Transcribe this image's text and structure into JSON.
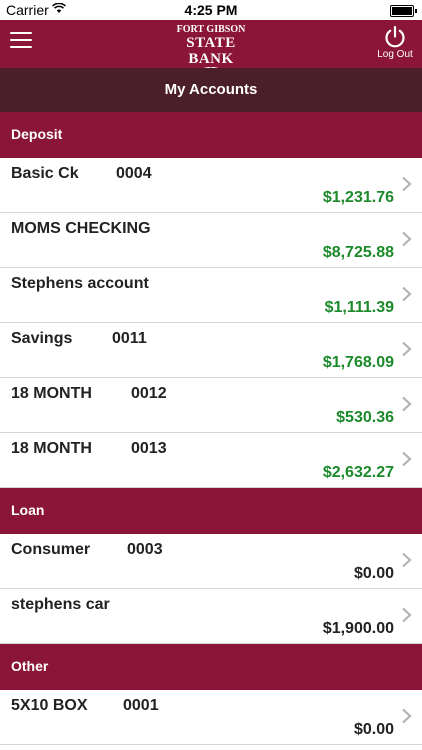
{
  "status_bar": {
    "carrier": "Carrier",
    "time": "4:25 PM"
  },
  "header": {
    "logo": {
      "line1": "FORT GIBSON",
      "line2": "STATE BANK"
    },
    "logout_label": "Log Out"
  },
  "title": "My Accounts",
  "sections": {
    "deposit": {
      "label": "Deposit",
      "accounts": [
        {
          "name": "Basic Ck",
          "number": "0004",
          "amount": "$1,231.76"
        },
        {
          "name": "MOMS CHECKING",
          "number": "",
          "amount": "$8,725.88"
        },
        {
          "name": "Stephens account",
          "number": "",
          "amount": "$1,111.39"
        },
        {
          "name": "Savings",
          "number": "0011",
          "amount": "$1,768.09"
        },
        {
          "name": "18 MONTH",
          "number": "0012",
          "amount": "$530.36"
        },
        {
          "name": "18 MONTH",
          "number": "0013",
          "amount": "$2,632.27"
        }
      ]
    },
    "loan": {
      "label": "Loan",
      "accounts": [
        {
          "name": "Consumer",
          "number": "0003",
          "amount": "$0.00"
        },
        {
          "name": "stephens car",
          "number": "",
          "amount": "$1,900.00"
        }
      ]
    },
    "other": {
      "label": "Other",
      "accounts": [
        {
          "name": "5X10 BOX",
          "number": "0001",
          "amount": "$0.00"
        }
      ]
    }
  },
  "colors": {
    "brand": "#8a1538",
    "title_bar": "#4a1f2a",
    "positive_amount": "#1c8a2b"
  }
}
